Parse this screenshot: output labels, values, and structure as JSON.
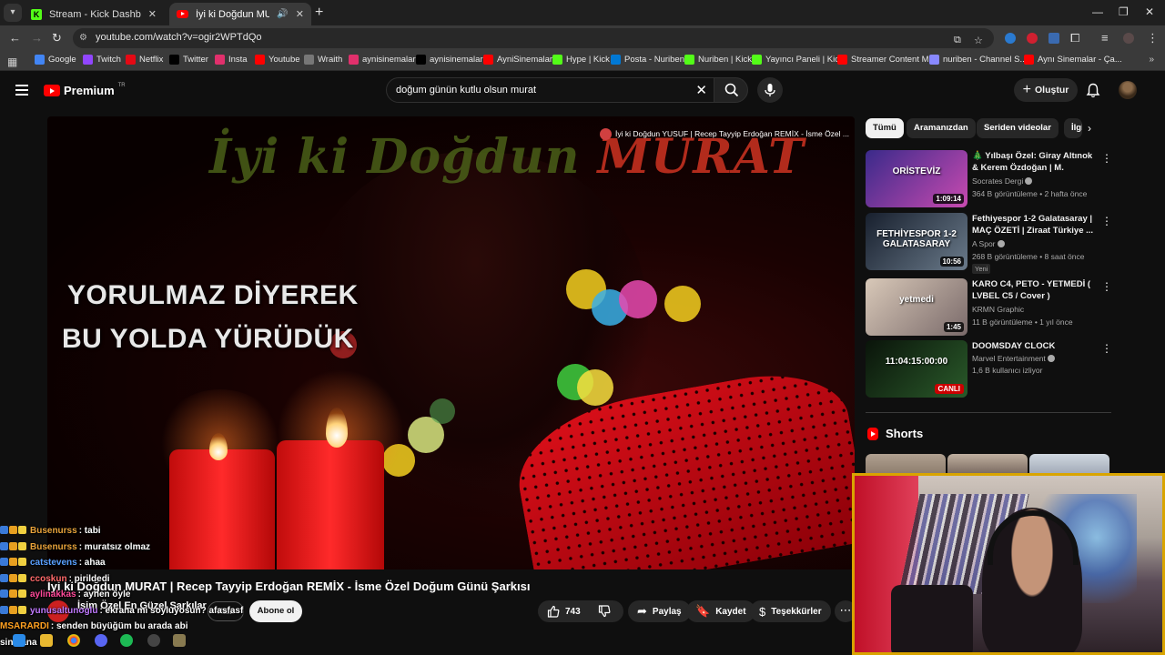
{
  "browser": {
    "tabs": [
      {
        "title": "Stream - Kick Dashboard",
        "icon": "kick-icon"
      },
      {
        "title": "İyi ki Doğdun MURAT | Recep",
        "icon": "youtube-icon",
        "active": true
      }
    ],
    "url": "youtube.com/watch?v=ogir2WPTdQo",
    "bookmarks": [
      {
        "label": "Google",
        "icon": "google-icon",
        "color": "#4285f4"
      },
      {
        "label": "Twitch",
        "icon": "twitch-icon",
        "color": "#9146ff"
      },
      {
        "label": "Netflix",
        "icon": "netflix-icon",
        "color": "#e50914"
      },
      {
        "label": "Twitter",
        "icon": "x-icon",
        "color": "#000000"
      },
      {
        "label": "Insta",
        "icon": "instagram-icon",
        "color": "#e1306c"
      },
      {
        "label": "Youtube",
        "icon": "youtube-icon",
        "color": "#ff0000"
      },
      {
        "label": "Wraith",
        "icon": "wraith-icon",
        "color": "#777777"
      },
      {
        "label": "aynisinemalar",
        "icon": "instagram-icon",
        "color": "#e1306c"
      },
      {
        "label": "aynisinemalar",
        "icon": "x-icon",
        "color": "#000000"
      },
      {
        "label": "AyniSinemalar",
        "icon": "youtube-icon",
        "color": "#ff0000"
      },
      {
        "label": "Hype | Kick",
        "icon": "kick-icon",
        "color": "#53fc18"
      },
      {
        "label": "Posta - Nuriben",
        "icon": "outlook-icon",
        "color": "#0078d4"
      },
      {
        "label": "Nuriben | Kick",
        "icon": "kick-icon",
        "color": "#53fc18"
      },
      {
        "label": "Yayıncı Paneli | Kick",
        "icon": "kick-icon",
        "color": "#53fc18"
      },
      {
        "label": "Streamer Content M...",
        "icon": "youtube-icon",
        "color": "#ff0000"
      },
      {
        "label": "nuriben - Channel S...",
        "icon": "globe-icon",
        "color": "#8888ff"
      },
      {
        "label": "Aynı Sinemalar - Ça...",
        "icon": "youtube-icon",
        "color": "#ff0000"
      }
    ]
  },
  "youtube": {
    "brand": "Premium",
    "country": "TR",
    "search_query": "doğum günün kutlu olsun murat",
    "create_label": "Oluştur"
  },
  "player": {
    "overlay_title_a": "İyi ki Doğdun ",
    "overlay_title_b": "MURAT",
    "lyrics_line1": "YORULMAZ DİYEREK",
    "lyrics_line2": "BU YOLDA YÜRÜDÜK",
    "next_video": "İyi ki Doğdun YUSUF | Recep Tayyip Erdoğan REMİX - İsme Özel ..."
  },
  "video": {
    "title": "İyi ki Doğdun MURAT | Recep Tayyip Erdoğan REMİX - İsme Özel Doğum Günü Şarkısı",
    "channel": "İsim Özel En Güzel Şarkılar",
    "join_label": "Katıl",
    "subscribe_label": "Abone ol",
    "likes": "743",
    "share_label": "Paylaş",
    "save_label": "Kaydet",
    "thanks_label": "Teşekkürler"
  },
  "filters": [
    "Tümü",
    "Aramanızdan",
    "Seriden videolar",
    "İlgili"
  ],
  "recommendations": [
    {
      "title": "🎄 Yılbaşı Özel: Giray Altınok & Kerem Özdoğan | M. Demirkol ...",
      "channel": "Socrates Dergi",
      "verified": true,
      "meta": "364 B görüntüleme • 2 hafta önce",
      "duration": "1:09:14",
      "badge": "",
      "thumb_text": "ORİSTEVİZ",
      "colors": [
        "#3a2a8a",
        "#c84ab0"
      ]
    },
    {
      "title": "Fethiyespor 1-2 Galatasaray | MAÇ ÖZETİ | Ziraat Türkiye ...",
      "channel": "A Spor",
      "verified": true,
      "meta": "268 B görüntüleme • 8 saat önce",
      "duration": "10:56",
      "badge": "Yeni",
      "thumb_text": "FETHİYESPOR 1-2 GALATASARAY",
      "colors": [
        "#18202e",
        "#6a7a8a"
      ]
    },
    {
      "title": "KARO C4, PETO - YETMEDİ ( LVBEL C5 / Cover )",
      "channel": "KRMN Graphic",
      "verified": false,
      "meta": "11 B görüntüleme • 1 yıl önce",
      "duration": "1:45",
      "badge": "",
      "thumb_text": "yetmedi",
      "colors": [
        "#d8c8b8",
        "#7a6a6a"
      ]
    },
    {
      "title": "DOOMSDAY CLOCK",
      "channel": "Marvel Entertainment",
      "verified": true,
      "meta": "1,6 B kullanıcı izliyor",
      "duration": "",
      "live": "CANLI",
      "badge": "",
      "thumb_text": "11:04:15:00:00",
      "colors": [
        "#0a140a",
        "#2a5a2a"
      ]
    }
  ],
  "shorts_label": "Shorts",
  "chat": [
    {
      "user": "Busenurss",
      "msg": ": tabi",
      "color": "#e8a23a"
    },
    {
      "user": "Busenurss",
      "msg": ": muratsız olmaz",
      "color": "#e8a23a"
    },
    {
      "user": "catstevens",
      "msg": ": ahaa",
      "color": "#5aa0ff"
    },
    {
      "user": "ccoskun",
      "msg": ": pirildedi",
      "color": "#ff6a6a"
    },
    {
      "user": "aylinakkas",
      "msg": ": aynen öyle",
      "color": "#ff4a9a"
    },
    {
      "user": "yunusaltunoglu",
      "msg": ": ekrana mi soyluyosun? afasfasf",
      "color": "#c07aff"
    },
    {
      "user": "MSARARDI",
      "msg": ": senden büyüğüm bu arada abi",
      "color": "#ffa020"
    },
    {
      "user": "",
      "msg": "sin bana",
      "color": "#ffffff"
    }
  ]
}
